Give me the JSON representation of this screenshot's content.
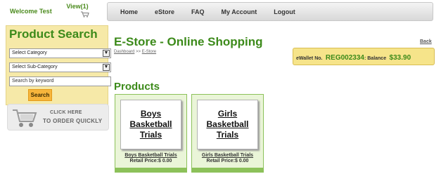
{
  "header": {
    "welcome": "Welcome Test",
    "view_cart": "View(1)",
    "nav": [
      "Home",
      "eStore",
      "FAQ",
      "My Account",
      "Logout"
    ]
  },
  "sidebar": {
    "title": "Product Search",
    "category_select": "Select Category",
    "subcategory_select": "Select Sub-Category",
    "keyword_value": "Search by keyword",
    "search_button": "Search",
    "order_banner_line1": "CLICK HERE",
    "order_banner_line2": "TO ORDER QUICKLY"
  },
  "main": {
    "title": "E-Store - Online Shopping",
    "breadcrumb": {
      "dashboard": "Dashboard",
      "separator": ">>",
      "estore": "E-Store"
    },
    "back_link": "Back",
    "wallet": {
      "label": "eWallet No.",
      "account": "REG002334",
      "balance_label": ": Balance",
      "balance": "$33.90"
    },
    "products_title": "Products",
    "products": [
      {
        "image_title": "Boys Basketball Trials",
        "name": "Boys Basketball Trials",
        "price": "Retail Price:$ 0.00"
      },
      {
        "image_title": "Girls Basketball Trials",
        "name": "Girls Basketball Trials",
        "price": "Retail Price:$ 0.00"
      }
    ]
  },
  "colors": {
    "brand_green": "#3c8a1a",
    "sidebar_bg": "#f6e9a8",
    "search_button": "#f6b53c",
    "wallet_bg": "#f6e48a",
    "card_border": "#8cc15a"
  }
}
